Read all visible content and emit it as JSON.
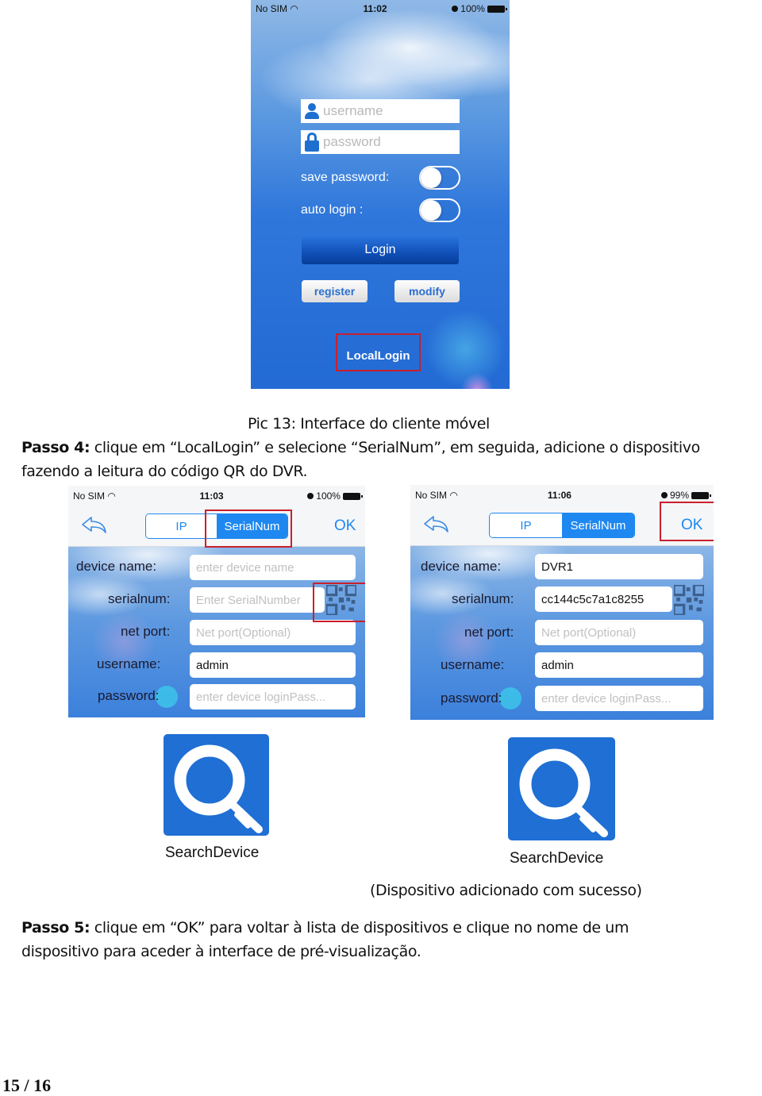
{
  "login_screen": {
    "status": {
      "carrier": "No SIM",
      "time": "11:02",
      "battery": "100%"
    },
    "username_placeholder": "username",
    "password_placeholder": "password",
    "save_password_label": "save password:",
    "auto_login_label": "auto login :",
    "save_password_on": false,
    "auto_login_on": false,
    "login_button": "Login",
    "register_button": "register",
    "modify_button": "modify",
    "local_login_button": "LocalLogin"
  },
  "caption_pic13": "Pic 13: Interface do cliente móvel",
  "step4": {
    "bold": "Passo 4:",
    "line1": " clique em “LocalLogin” e selecione “SerialNum”, em seguida, adicione o dispositivo",
    "line2": "fazendo a leitura do código QR do DVR."
  },
  "add_device_empty": {
    "status": {
      "carrier": "No SIM",
      "time": "11:03",
      "battery": "100%"
    },
    "tabs": [
      "IP",
      "SerialNum"
    ],
    "active_tab": "SerialNum",
    "ok_button": "OK",
    "labels": {
      "device_name": "device name:",
      "serialnum": "serialnum:",
      "net_port": "net port:",
      "username": "username:",
      "password": "password:"
    },
    "fields": {
      "device_name_placeholder": "enter device name",
      "serialnum_placeholder": "Enter SerialNumber",
      "net_port_placeholder": "Net port(Optional)",
      "username_value": "admin",
      "password_placeholder": "enter device loginPass..."
    },
    "search_label": "SearchDevice"
  },
  "add_device_filled": {
    "status": {
      "carrier": "No SIM",
      "time": "11:06",
      "battery": "99%"
    },
    "tabs": [
      "IP",
      "SerialNum"
    ],
    "active_tab": "SerialNum",
    "ok_button": "OK",
    "labels": {
      "device_name": "device name:",
      "serialnum": "serialnum:",
      "net_port": "net port:",
      "username": "username:",
      "password": "password:"
    },
    "fields": {
      "device_name_value": "DVR1",
      "serialnum_value": "cc144c5c7a1c8255",
      "net_port_placeholder": "Net port(Optional)",
      "username_value": "admin",
      "password_placeholder": "enter device loginPass..."
    },
    "search_label": "SearchDevice"
  },
  "success_caption": "(Dispositivo adicionado com sucesso)",
  "step5": {
    "bold": "Passo 5:",
    "line1": " clique em “OK” para voltar à lista de dispositivos e clique no nome de um",
    "line2": "dispositivo para aceder à interface de pré-visualização."
  },
  "page_number": "15 / 16",
  "colors": {
    "accent_blue": "#1e88f0",
    "highlight_red": "#c8202d",
    "tile_blue": "#1f6fd4"
  }
}
